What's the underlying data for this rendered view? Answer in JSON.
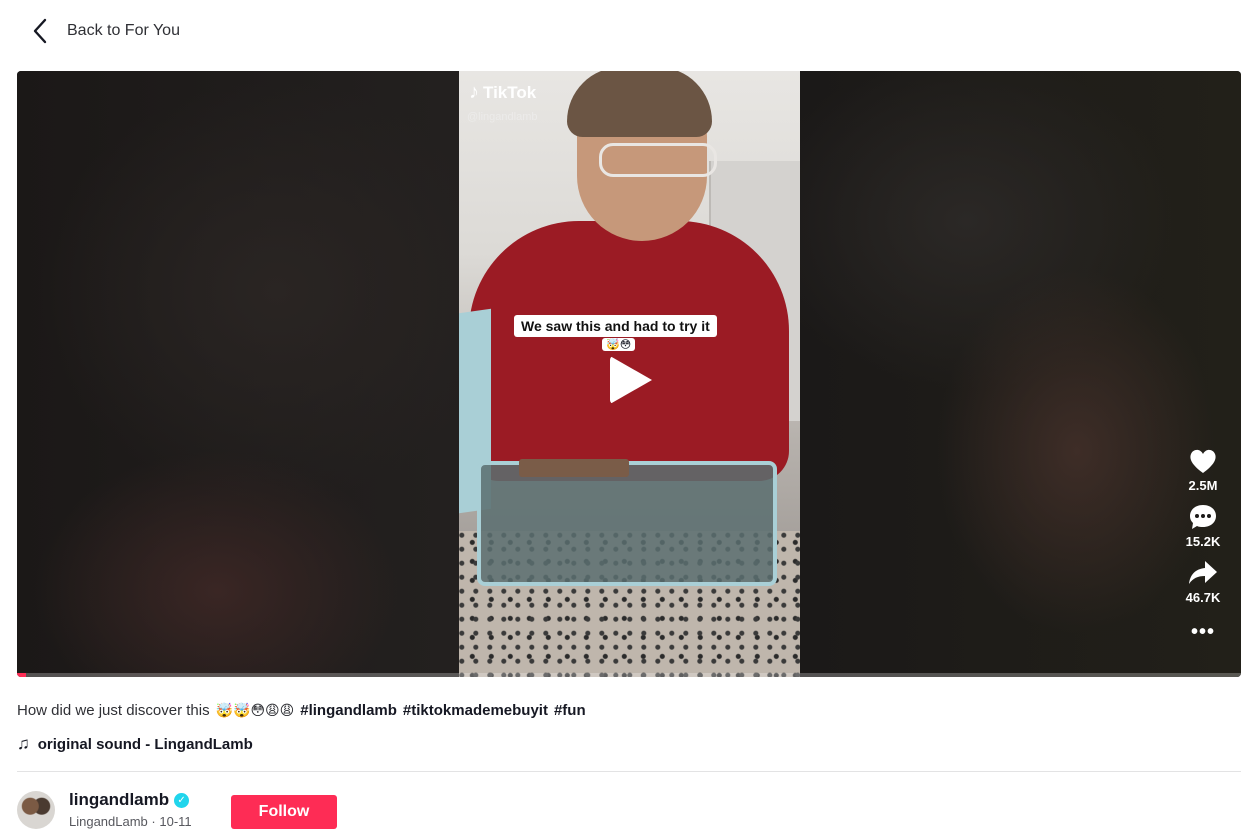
{
  "nav": {
    "back_label": "Back to For You"
  },
  "video": {
    "brand": "TikTok",
    "handle": "@lingandlamb",
    "caption": "We saw this and had to try it",
    "caption_emoji": "🤯😳",
    "progress": 0.007
  },
  "actions": {
    "likes": "2.5M",
    "comments": "15.2K",
    "shares": "46.7K"
  },
  "post": {
    "description": "How did we just discover this",
    "emojis": "🤯🤯😳😩😩",
    "hashtags": [
      "#lingandlamb",
      "#tiktokmademebuyit",
      "#fun"
    ],
    "sound": "original sound - LingandLamb"
  },
  "author": {
    "username": "lingandlamb",
    "display_name": "LingandLamb",
    "date": "10-11",
    "follow_label": "Follow"
  },
  "colors": {
    "accent": "#fe2c55",
    "verified": "#20d5ec"
  }
}
